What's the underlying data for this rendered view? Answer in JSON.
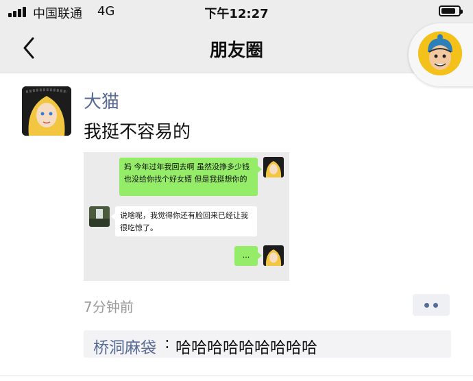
{
  "status_bar": {
    "carrier": "中国联通",
    "network": "4G",
    "time": "下午12:27"
  },
  "nav": {
    "title": "朋友圈"
  },
  "post": {
    "author": "大猫",
    "text": "我挺不容易的",
    "time_ago": "7分钟前",
    "image": {
      "messages": [
        {
          "side": "right",
          "text": "妈 今年过年我回去啊 虽然没挣多少钱 也没给你找个好女婿 但是我挺想你的"
        },
        {
          "side": "left",
          "text": "说啥呢，我觉得你还有脸回来已经让我很吃惊了。"
        },
        {
          "side": "right",
          "text": "..."
        }
      ]
    },
    "comments": [
      {
        "author": "桥洞麻袋",
        "separator": ":",
        "text": "哈哈哈哈哈哈哈哈哈"
      }
    ]
  },
  "colors": {
    "link": "#576b95",
    "chat_green": "#95ec69",
    "nav_bg": "#ededed"
  },
  "icons": {
    "back": "chevron-left-icon",
    "more": "more-dots-icon"
  }
}
